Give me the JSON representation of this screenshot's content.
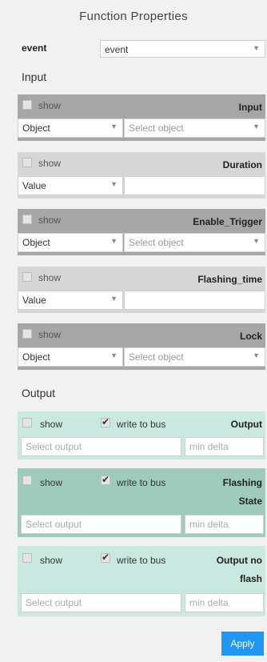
{
  "title": "Function Properties",
  "event": {
    "label": "event",
    "value": "event"
  },
  "input_section": {
    "label": "Input"
  },
  "inputs": [
    {
      "show_label": "show",
      "name": "Input",
      "type": "Object",
      "target_placeholder": "Select object"
    },
    {
      "show_label": "show",
      "name": "Duration",
      "type": "Value",
      "target_placeholder": ""
    },
    {
      "show_label": "show",
      "name": "Enable_Trigger",
      "type": "Object",
      "target_placeholder": "Select object"
    },
    {
      "show_label": "show",
      "name": "Flashing_time",
      "type": "Value",
      "target_placeholder": ""
    },
    {
      "show_label": "show",
      "name": "Lock",
      "type": "Object",
      "target_placeholder": "Select object"
    }
  ],
  "output_section": {
    "label": "Output"
  },
  "outputs": [
    {
      "show_label": "show",
      "write_label": "write to bus",
      "name_line1": "Output",
      "name_line2": "",
      "output_placeholder": "Select output",
      "delta_placeholder": "min delta"
    },
    {
      "show_label": "show",
      "write_label": "write to bus",
      "name_line1": "Flashing",
      "name_line2": "State",
      "output_placeholder": "Select output",
      "delta_placeholder": "min delta"
    },
    {
      "show_label": "show",
      "write_label": "write to bus",
      "name_line1": "Output no",
      "name_line2": "flash",
      "output_placeholder": "Select output",
      "delta_placeholder": "min delta"
    }
  ],
  "apply_label": "Apply",
  "icons": {
    "dropdown": "chevron-down-icon",
    "check": "checkmark-icon"
  },
  "colors": {
    "accent": "#2196f3",
    "dark_row": "#a6a6a6",
    "light_row": "#d6d6d6",
    "output_row": "#c9e8df",
    "output_row_alt": "#9fcbbd"
  }
}
